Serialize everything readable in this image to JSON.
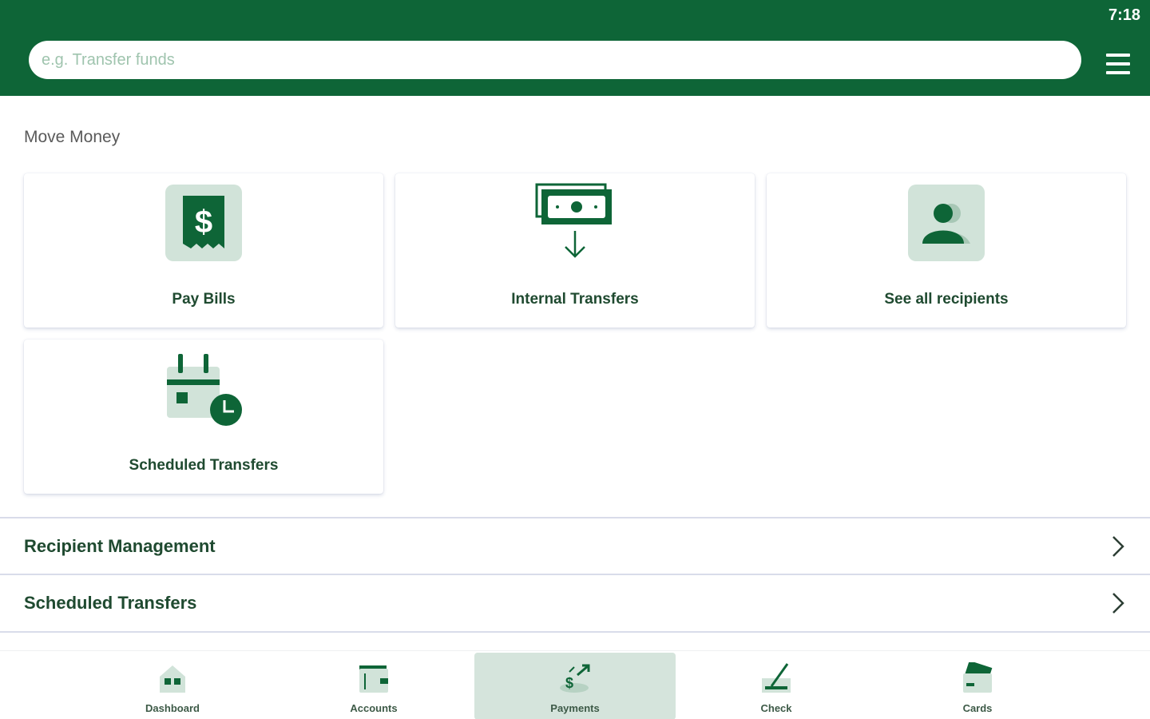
{
  "status": {
    "time": "7:18"
  },
  "search": {
    "placeholder": "e.g. Transfer funds"
  },
  "section": {
    "title": "Move Money"
  },
  "tiles": [
    {
      "label": "Pay Bills",
      "icon": "receipt-dollar-icon"
    },
    {
      "label": "Internal Transfers",
      "icon": "money-transfer-icon"
    },
    {
      "label": "See all recipients",
      "icon": "recipients-icon"
    },
    {
      "label": "Scheduled Transfers",
      "icon": "calendar-clock-icon"
    }
  ],
  "rows": [
    {
      "label": "Recipient Management"
    },
    {
      "label": "Scheduled Transfers"
    }
  ],
  "nav": [
    {
      "label": "Dashboard",
      "icon": "home-icon",
      "active": false
    },
    {
      "label": "Accounts",
      "icon": "wallet-icon",
      "active": false
    },
    {
      "label": "Payments",
      "icon": "payments-icon",
      "active": true
    },
    {
      "label": "Check",
      "icon": "check-deposit-icon",
      "active": false
    },
    {
      "label": "Cards",
      "icon": "card-icon",
      "active": false
    }
  ],
  "colors": {
    "brand": "#0e6537",
    "tile_icon_bg": "#d1e3d9",
    "active_nav": "#d5e4dc"
  }
}
